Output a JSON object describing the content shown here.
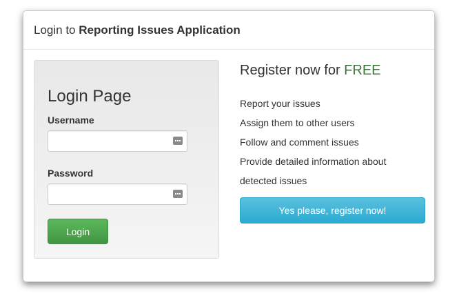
{
  "header": {
    "prefix": "Login to ",
    "app_name": "Reporting Issues Application"
  },
  "login": {
    "title": "Login Page",
    "username_label": "Username",
    "username_value": "",
    "password_label": "Password",
    "password_value": "",
    "button_label": "Login"
  },
  "register": {
    "title_prefix": "Register now for ",
    "title_free": "FREE",
    "features": [
      "Report your issues",
      "Assign them to other users",
      "Follow and comment issues",
      "Provide detailed information about",
      "detected issues"
    ],
    "button_label": "Yes please, register now!"
  },
  "colors": {
    "login_button": "#5cb85c",
    "register_button": "#5bc0de",
    "free_text": "#3c763d"
  },
  "icons": {
    "field_icon": "password-manager-icon"
  }
}
